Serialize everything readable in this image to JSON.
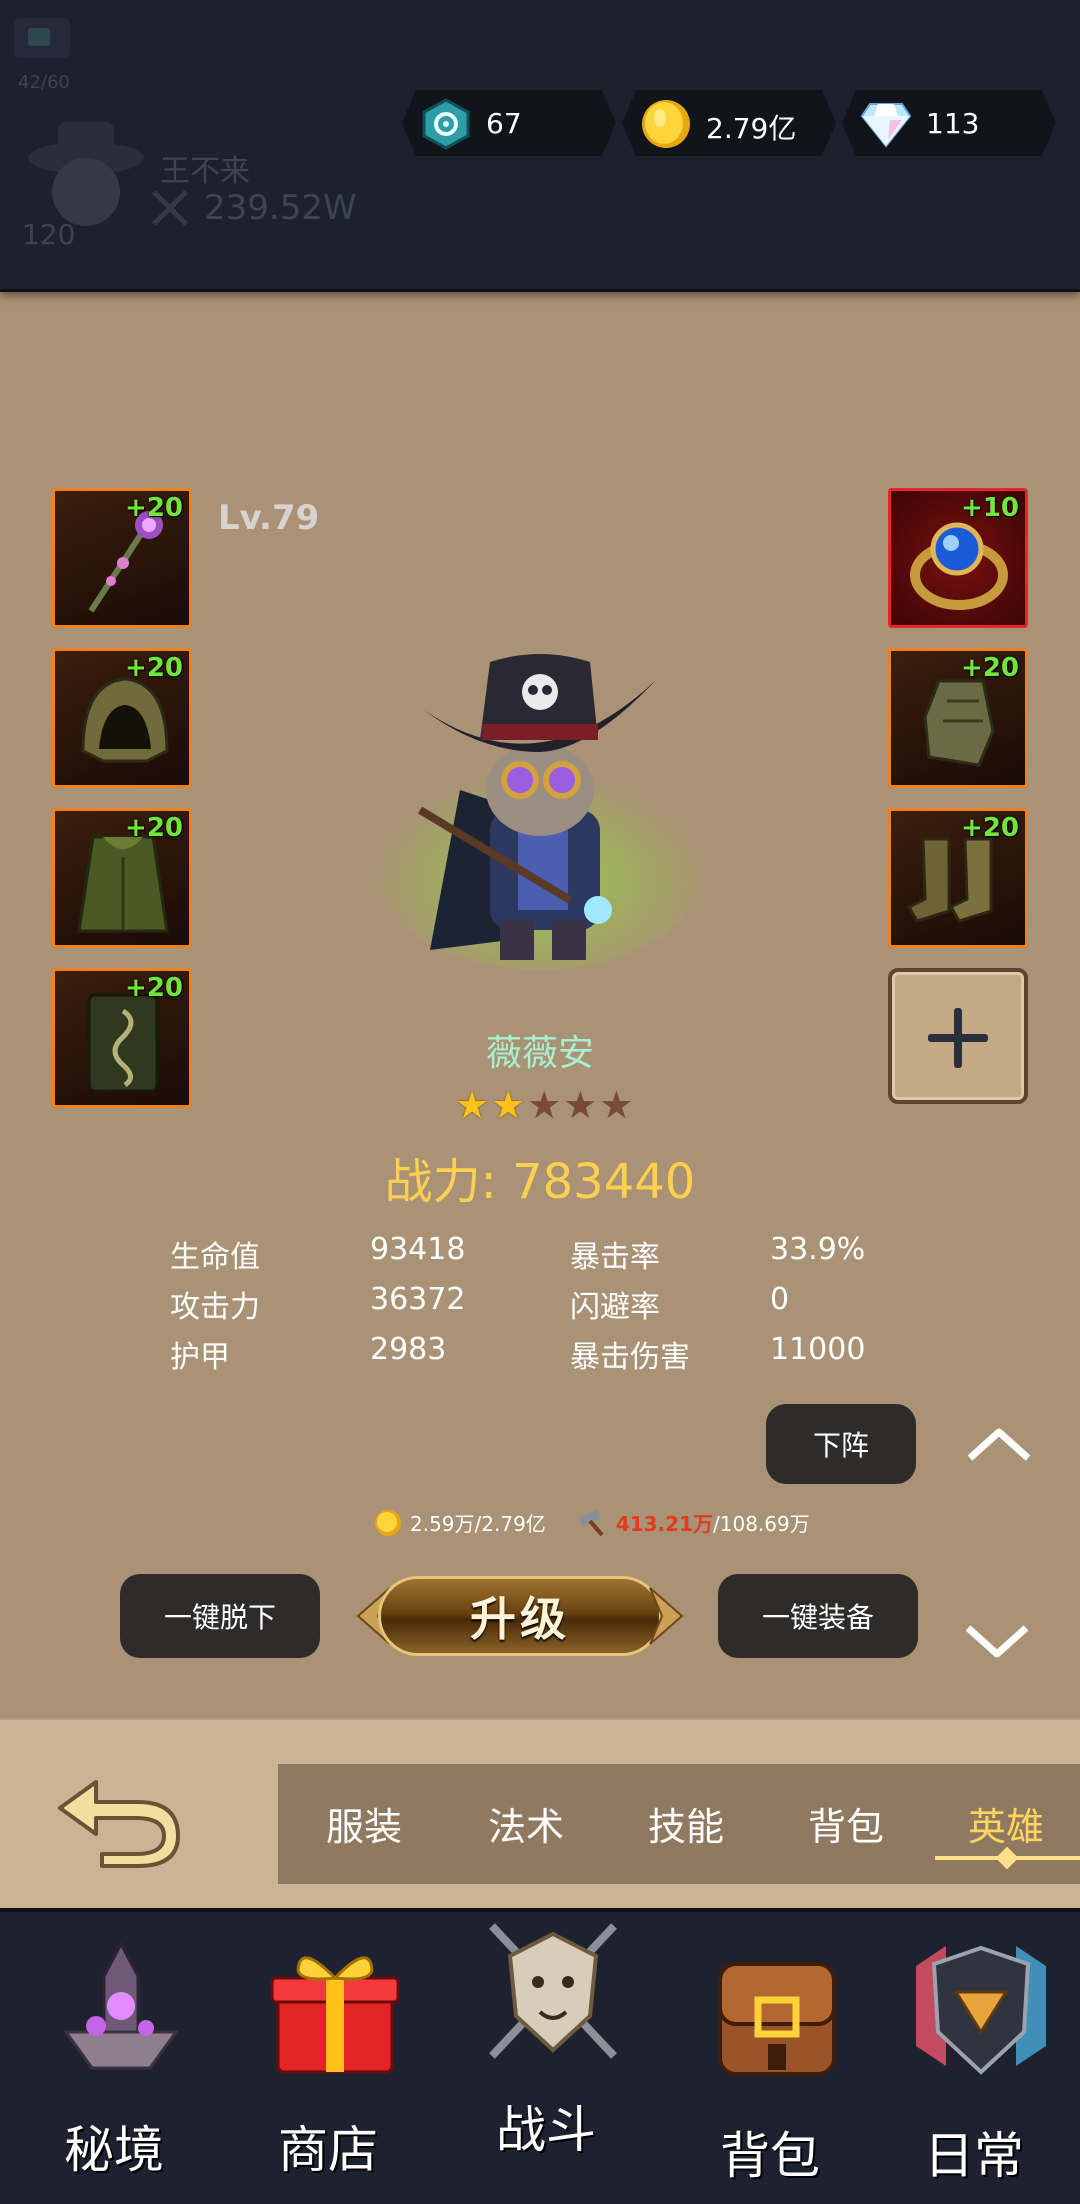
{
  "header": {
    "stage_progress": "42/60",
    "player_name": "王不来",
    "player_level": "120",
    "player_power": "239.52W",
    "currencies": [
      {
        "icon": "crystal-icon",
        "value": "67"
      },
      {
        "icon": "gold-coin-icon",
        "value": "2.79亿"
      },
      {
        "icon": "diamond-icon",
        "value": "113"
      }
    ]
  },
  "hero": {
    "level": "Lv.79",
    "name": "薇薇安",
    "stars_filled": 2,
    "stars_total": 5,
    "power_label": "战力: 783440"
  },
  "equipment": {
    "left": [
      {
        "item": "staff",
        "plus": "+20"
      },
      {
        "item": "helmet",
        "plus": "+20"
      },
      {
        "item": "armor",
        "plus": "+20"
      },
      {
        "item": "pants",
        "plus": "+20"
      }
    ],
    "right": [
      {
        "item": "ring",
        "plus": "+10"
      },
      {
        "item": "gloves",
        "plus": "+20"
      },
      {
        "item": "boots",
        "plus": "+20"
      }
    ]
  },
  "stats": {
    "hp_label": "生命值",
    "hp_value": "93418",
    "atk_label": "攻击力",
    "atk_value": "36372",
    "armor_label": "护甲",
    "armor_value": "2983",
    "crit_rate_label": "暴击率",
    "crit_rate_value": "33.9%",
    "dodge_label": "闪避率",
    "dodge_value": "0",
    "crit_dmg_label": "暴击伤害",
    "crit_dmg_value": "11000"
  },
  "actions": {
    "dismiss_label": "下阵",
    "unequip_all_label": "一键脱下",
    "upgrade_label": "升级",
    "equip_all_label": "一键装备",
    "gold_cost": "2.59万/2.79亿",
    "material_cost_required": "413.21万",
    "material_cost_owned": "/108.69万"
  },
  "tabs": [
    {
      "label": "服装",
      "active": false
    },
    {
      "label": "法术",
      "active": false
    },
    {
      "label": "技能",
      "active": false
    },
    {
      "label": "背包",
      "active": false
    },
    {
      "label": "英雄",
      "active": true
    }
  ],
  "bottom_nav": [
    {
      "label": "秘境",
      "icon": "floating-island-icon"
    },
    {
      "label": "商店",
      "icon": "gift-box-icon"
    },
    {
      "label": "战斗",
      "icon": "lion-crest-icon"
    },
    {
      "label": "背包",
      "icon": "satchel-icon"
    },
    {
      "label": "日常",
      "icon": "shield-emblem-icon"
    }
  ],
  "colors": {
    "background": "#a99275",
    "topbar": "#1d202d",
    "power": "#fbd04f",
    "hero_name": "#a8f0cf",
    "plus_green": "#6fe83b",
    "slot_border": "#f07f1c",
    "slot_border_ring": "#e62626",
    "active_tab": "#ffd55e"
  }
}
